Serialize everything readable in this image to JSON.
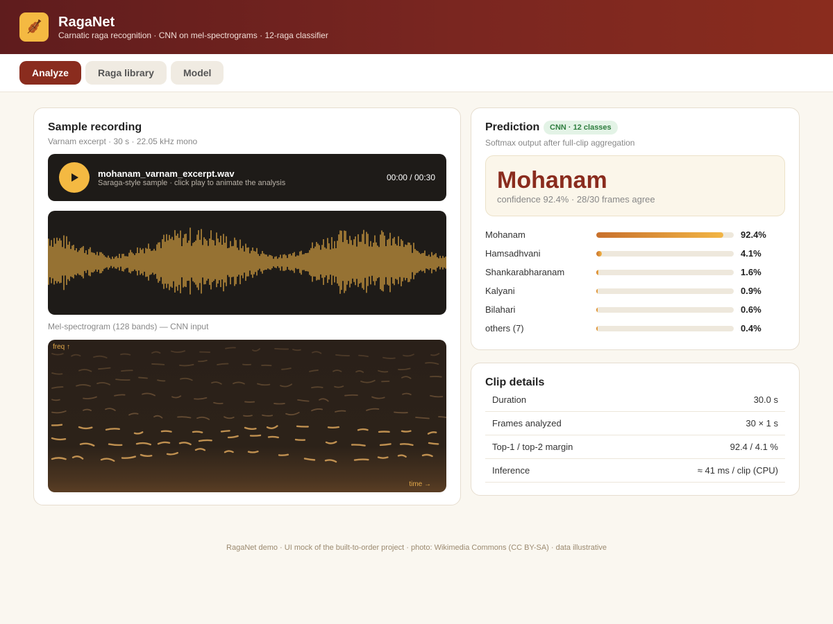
{
  "app": {
    "title": "RagaNet",
    "subtitle": "Carnatic raga recognition · CNN on mel-spectrograms · 12-raga classifier",
    "logo_icon": "violin-icon",
    "accent": "#8a2c1e",
    "gold": "#f4b942"
  },
  "tabs": [
    {
      "label": "Analyze",
      "active": true
    },
    {
      "label": "Raga library",
      "active": false
    },
    {
      "label": "Model",
      "active": false
    }
  ],
  "sample": {
    "title": "Sample recording",
    "subtitle": "Varnam excerpt · 30 s · 22.05 kHz mono",
    "file_name": "mohanam_varnam_excerpt.wav",
    "file_sub": "Saraga-style sample · click play to animate the analysis",
    "time": "00:00 / 00:30",
    "play_icon": "play-icon",
    "spectrogram_label": "Mel-spectrogram (128 bands) — CNN input",
    "freq_axis": "freq ↑",
    "time_axis": "time →"
  },
  "prediction": {
    "title": "Prediction",
    "badge": "CNN · 12 classes",
    "subtitle": "Softmax output after full-clip aggregation",
    "top_raga": "Mohanam",
    "top_confidence": "confidence 92.4% · 28/30 frames agree",
    "probabilities": [
      {
        "name": "Mohanam",
        "value": 92.4,
        "label": "92.4%"
      },
      {
        "name": "Hamsadhvani",
        "value": 4.1,
        "label": "4.1%"
      },
      {
        "name": "Shankarabharanam",
        "value": 1.6,
        "label": "1.6%"
      },
      {
        "name": "Kalyani",
        "value": 0.9,
        "label": "0.9%"
      },
      {
        "name": "Bilahari",
        "value": 0.6,
        "label": "0.6%"
      },
      {
        "name": "others (7)",
        "value": 0.4,
        "label": "0.4%"
      }
    ]
  },
  "details": {
    "title": "Clip details",
    "rows": [
      {
        "key": "Duration",
        "value": "30.0 s"
      },
      {
        "key": "Frames analyzed",
        "value": "30 × 1 s"
      },
      {
        "key": "Top-1 / top-2 margin",
        "value": "92.4 / 4.1 %"
      },
      {
        "key": "Inference",
        "value": "≈ 41 ms / clip (CPU)"
      }
    ]
  },
  "footer": "RagaNet demo · UI mock of the built-to-order project · photo: Wikimedia Commons (CC BY-SA) · data illustrative"
}
